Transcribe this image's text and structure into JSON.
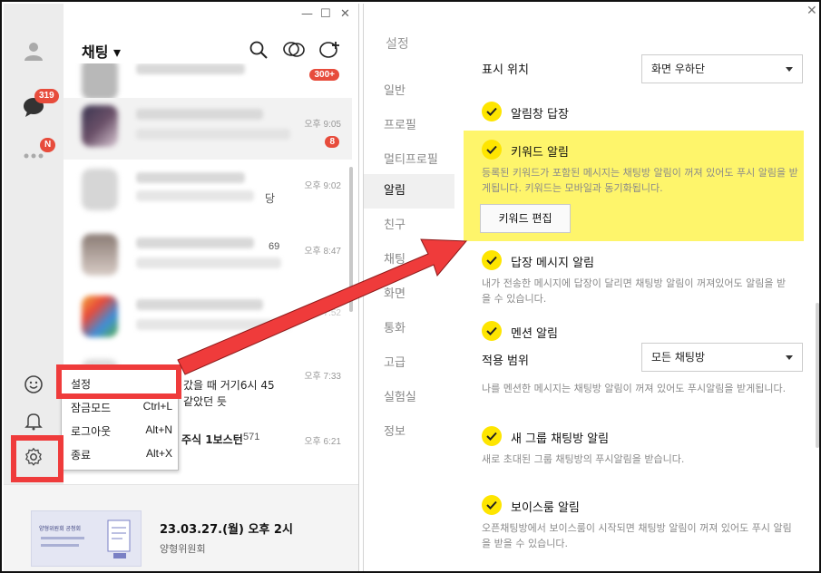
{
  "left_window": {
    "controls": [
      "—",
      "☐",
      "✕"
    ],
    "rail": {
      "chat_badge": "319",
      "more_badge": "N"
    },
    "header": {
      "title": "채팅 ▾"
    },
    "chat_items": [
      {
        "time": "",
        "badge": "300+",
        "count": "",
        "trailing": ""
      },
      {
        "time": "오후 9:05",
        "badge": "8",
        "count": "",
        "trailing": ""
      },
      {
        "time": "오후 9:02",
        "badge": "",
        "count": "",
        "trailing": "당"
      },
      {
        "time": "오후 8:47",
        "badge": "",
        "count": "69",
        "trailing": ""
      },
      {
        "time": "오후 7:52",
        "badge": "",
        "count": "",
        "trailing": ""
      },
      {
        "time": "오후 7:33",
        "badge": "",
        "count": "",
        "trailing": ""
      },
      {
        "time": "오후 6:21",
        "badge": "",
        "count": "571",
        "trailing": ""
      }
    ],
    "overlay_texts": {
      "line1": "갔을 때 거기6시 45",
      "line2": "같았던 듯",
      "line3": "주식 1보스턴"
    },
    "popup_menu": [
      {
        "label": "설정",
        "shortcut": ""
      },
      {
        "label": "잠금모드",
        "shortcut": "Ctrl+L"
      },
      {
        "label": "로그아웃",
        "shortcut": "Alt+N"
      },
      {
        "label": "종료",
        "shortcut": "Alt+X"
      }
    ],
    "banner": {
      "image_text": "양형위원회 공청회",
      "title": "23.03.27.(월) 오후 2시",
      "subtitle": "양형위원회"
    }
  },
  "settings": {
    "title": "설정",
    "menu": [
      "일반",
      "프로필",
      "멀티프로필",
      "알림",
      "친구",
      "채팅",
      "화면",
      "통화",
      "고급",
      "실험실",
      "정보"
    ],
    "active_menu": "알림",
    "display_position_label": "표시 위치",
    "display_position_value": "화면 우하단",
    "options": {
      "reply_in_notification": "알림창 답장",
      "keyword_alert": "키워드 알림",
      "keyword_desc": "등록된 키워드가 포함된 메시지는 채팅방 알림이 꺼져 있어도 푸시 알림을 받게됩니다. 키워드는 모바일과 동기화됩니다.",
      "keyword_edit_button": "키워드 편집",
      "reply_alert": "답장 메시지 알림",
      "reply_desc": "내가 전송한 메시지에 답장이 달리면 채팅방 알림이 꺼져있어도 알림을 받을 수 있습니다.",
      "mention_alert": "멘션 알림",
      "scope_label": "적용 범위",
      "scope_value": "모든 채팅방",
      "mention_desc": "나를 멘션한 메시지는 채팅방 알림이 꺼져 있어도 푸시알림을 받게됩니다.",
      "new_group_alert": "새 그룹 채팅방 알림",
      "new_group_desc": "새로 초대된 그룹 채팅방의 푸시알림을 받습니다.",
      "voice_room_alert": "보이스룸 알림",
      "voice_room_desc": "오픈채팅방에서 보이스룸이 시작되면 채팅방 알림이 꺼져 있어도 푸시 알림을 받을 수 있습니다."
    },
    "close": "✕"
  },
  "colors": {
    "accent_yellow": "#fee500",
    "highlight": "#fef56b",
    "annotation_red": "#ef3b3b",
    "badge_red": "#e74c3c"
  }
}
